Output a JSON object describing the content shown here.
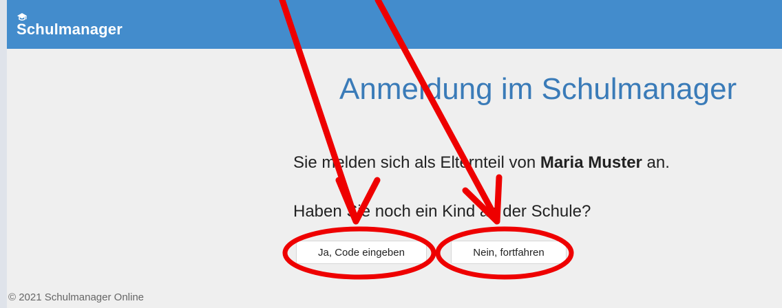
{
  "navbar": {
    "brand": "Schulmanager"
  },
  "main": {
    "heading": "Anmeldung im Schulmanager",
    "intro_prefix": "Sie melden sich als Elternteil von ",
    "child_name": "Maria Muster",
    "intro_suffix": " an.",
    "question": "Haben Sie noch ein Kind an der Schule?",
    "yes_button": "Ja, Code eingeben",
    "no_button": "Nein, fortfahren"
  },
  "footer": {
    "copyright": "© 2021 Schulmanager Online"
  },
  "colors": {
    "navbar": "#438ccc",
    "heading": "#3a7bb8",
    "annotation": "#ee0000"
  },
  "icons": {
    "brand_icon": "graduation-cap-icon"
  }
}
